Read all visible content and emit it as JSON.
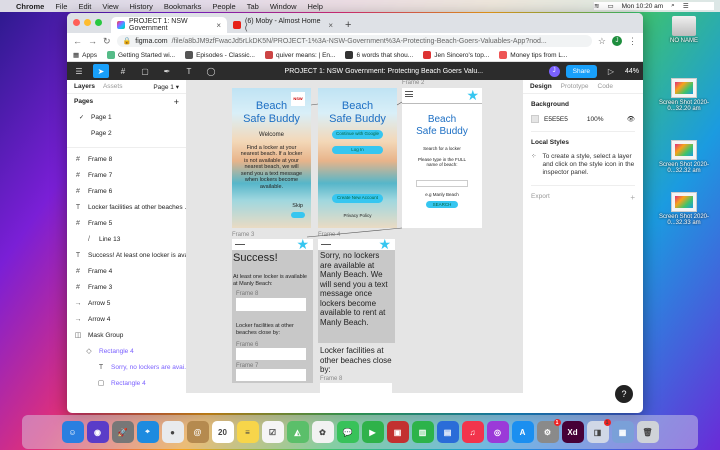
{
  "menubar": {
    "app": "Chrome",
    "items": [
      "File",
      "Edit",
      "View",
      "History",
      "Bookmarks",
      "People",
      "Tab",
      "Window",
      "Help"
    ],
    "clock": "Mon 10:20 am"
  },
  "desktop": {
    "drive_label": "NO NAME",
    "screenshots": [
      "Screen Shot 2020-0...32.20 am",
      "Screen Shot 2020-0...32.32 am",
      "Screen Shot 2020-0...32.33 am"
    ]
  },
  "browser": {
    "tabs": [
      {
        "label": "PROJECT 1: NSW Government",
        "active": true
      },
      {
        "label": "(6) Moby - Almost Home (",
        "active": false
      }
    ],
    "new_tab": "+",
    "url_host": "figma.com",
    "url_path": "/file/a8bJM9zfFwacJd5rLkDK5N/PROJECT-1%3A-NSW-Government%3A-Protecting-Beach-Goers-Valuables-App?nod...",
    "account_initial": "J",
    "bookmarks": [
      "Apps",
      "Getting Started wi...",
      "Episodes - Classic...",
      "quiver means: | En...",
      "6 words that shou...",
      "Jen Sincero's top...",
      "Money tips from L..."
    ]
  },
  "figma": {
    "file_title": "PROJECT 1: NSW Government: Protecting Beach Goers Valu...",
    "user_initial": "J",
    "share_label": "Share",
    "zoom": "44%",
    "left_tabs": {
      "layers": "Layers",
      "assets": "Assets",
      "page": "Page 1"
    },
    "pages_heading": "Pages",
    "pages": [
      "Page 1",
      "Page 2"
    ],
    "layers": [
      {
        "icon": "#",
        "label": "Frame 8",
        "indent": 0
      },
      {
        "icon": "#",
        "label": "Frame 7",
        "indent": 0
      },
      {
        "icon": "#",
        "label": "Frame 6",
        "indent": 0
      },
      {
        "icon": "T",
        "label": "Locker facilities at other beaches ...",
        "indent": 0
      },
      {
        "icon": "#",
        "label": "Frame 5",
        "indent": 0
      },
      {
        "icon": "/",
        "label": "Line 13",
        "indent": 1
      },
      {
        "icon": "T",
        "label": "Success! At least one locker is ava...",
        "indent": 0
      },
      {
        "icon": "#",
        "label": "Frame 4",
        "indent": 0
      },
      {
        "icon": "#",
        "label": "Frame 3",
        "indent": 0
      },
      {
        "icon": "→",
        "label": "Arrow 5",
        "indent": 0
      },
      {
        "icon": "→",
        "label": "Arrow 4",
        "indent": 0
      },
      {
        "icon": "◫",
        "label": "Mask Group",
        "indent": 0
      },
      {
        "icon": "◇",
        "label": "Rectangle 4",
        "indent": 1
      },
      {
        "icon": "T",
        "label": "Sorry, no lockers are avai...",
        "indent": 2
      },
      {
        "icon": "▢",
        "label": "Rectangle 4",
        "indent": 2
      },
      {
        "icon": "#",
        "label": "Rectangle 3",
        "indent": 0
      }
    ],
    "right_tabs": {
      "design": "Design",
      "prototype": "Prototype",
      "code": "Code"
    },
    "background": {
      "heading": "Background",
      "hex": "E5E5E5",
      "opacity": "100%"
    },
    "local_styles": {
      "heading": "Local Styles",
      "note": "To create a style, select a layer and click on the style icon in the inspector panel."
    },
    "export": {
      "heading": "Export"
    },
    "help": "?",
    "colors": {
      "accent": "#18a0fb",
      "canvas": "#e5e5e5",
      "toolbar": "#2c2c2c",
      "beach_blue": "#1d6fc4",
      "cyan": "#36c6f0"
    }
  },
  "canvas": {
    "frame1": {
      "title1": "Beach",
      "title2": "Safe Buddy",
      "badge": "NSW",
      "welcome": "Welcome",
      "body": "Find a locker at your nearest beach. If a locker is not available at your nearest beach, we will send you a text message when lockers become available.",
      "skip": "Skip"
    },
    "frame_top_middle": {
      "title1": "Beach",
      "title2": "Safe Buddy",
      "btn1": "Continue with Google",
      "btn2": "Log In",
      "btn3": "Create New Account",
      "privacy": "Privacy Policy"
    },
    "frame2": {
      "label": "Frame 2",
      "title1": "Beach",
      "title2": "Safe Buddy",
      "line1": "Search for a locker",
      "line2": "Please type in the FULL name of beach:",
      "example": "e.g Manly Beach",
      "search": "SEARCH"
    },
    "frame3": {
      "label": "Frame 3",
      "success": "Success!",
      "text": "At least one locker is available at Manly Beach:",
      "f8": "Frame 8",
      "other": "Locker facilities at other beaches close by:",
      "f6": "Frame 6",
      "f7": "Frame 7"
    },
    "frame4": {
      "label": "Frame 4",
      "sorry": "Sorry, no lockers are available at Manly Beach. We will send you a text message once lockers become available to rent at Manly Beach.",
      "other": "Locker facilities at other beaches close by:",
      "f8": "Frame 8"
    }
  },
  "dock": {
    "apps": [
      {
        "name": "finder",
        "color": "#2a7fe0",
        "glyph": "☺"
      },
      {
        "name": "siri",
        "color": "#5a3cc8",
        "glyph": "◉"
      },
      {
        "name": "launchpad",
        "color": "#777",
        "glyph": "🚀"
      },
      {
        "name": "safari",
        "color": "#1e8be0",
        "glyph": "⌖"
      },
      {
        "name": "chrome",
        "color": "#e8eaed",
        "glyph": "●"
      },
      {
        "name": "contacts",
        "color": "#b58a4f",
        "glyph": "@"
      },
      {
        "name": "calendar",
        "color": "#ffffff",
        "glyph": "20"
      },
      {
        "name": "notes",
        "color": "#f7d54a",
        "glyph": "≡"
      },
      {
        "name": "reminders",
        "color": "#f5f5f5",
        "glyph": "☑"
      },
      {
        "name": "maps",
        "color": "#5bbf6a",
        "glyph": "◭"
      },
      {
        "name": "photos",
        "color": "#f2f2f2",
        "glyph": "✿"
      },
      {
        "name": "messages",
        "color": "#38c25a",
        "glyph": "💬"
      },
      {
        "name": "facetime",
        "color": "#2fb24a",
        "glyph": "▶"
      },
      {
        "name": "photo-booth",
        "color": "#c23030",
        "glyph": "▣"
      },
      {
        "name": "numbers",
        "color": "#2db34a",
        "glyph": "▥"
      },
      {
        "name": "keynote",
        "color": "#2a6cd8",
        "glyph": "▤"
      },
      {
        "name": "music",
        "color": "#f2344c",
        "glyph": "♫"
      },
      {
        "name": "podcasts",
        "color": "#9b3ad8",
        "glyph": "◎"
      },
      {
        "name": "app-store",
        "color": "#1b8ff0",
        "glyph": "A"
      },
      {
        "name": "system-preferences",
        "color": "#8a8a8a",
        "glyph": "⚙",
        "badge": "1"
      },
      {
        "name": "adobe-xd",
        "color": "#470137",
        "glyph": "Xd"
      },
      {
        "name": "preview",
        "color": "#d0d7e6",
        "glyph": "◨",
        "badge": "1"
      },
      {
        "name": "finder-window",
        "color": "#7aa0d8",
        "glyph": "▦"
      },
      {
        "name": "trash",
        "color": "#cfd3d8",
        "glyph": "🗑"
      }
    ]
  }
}
